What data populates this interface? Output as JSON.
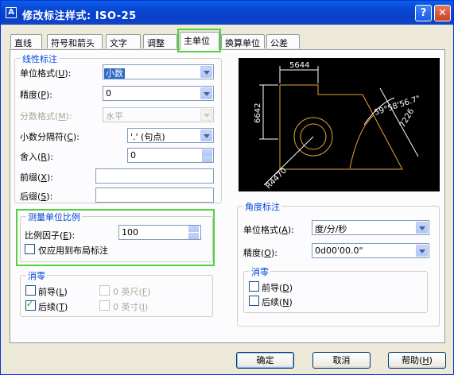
{
  "window": {
    "title": "修改标注样式: ISO-25",
    "help_glyph": "?",
    "close_glyph": "✕",
    "icon": "dimension-style-icon"
  },
  "tabs": [
    "直线",
    "符号和箭头",
    "文字",
    "调整",
    "主单位",
    "换算单位",
    "公差"
  ],
  "active_tab": "主单位",
  "linear": {
    "group_label": "线性标注",
    "unit_format_label": "单位格式",
    "unit_format_key": "U",
    "unit_format_value": "小数",
    "precision_label": "精度",
    "precision_key": "P",
    "precision_value": "0",
    "fraction_format_label": "分数格式",
    "fraction_format_key": "M",
    "fraction_format_value": "水平",
    "decimal_separator_label": "小数分隔符",
    "decimal_separator_key": "C",
    "decimal_separator_value": "'.' (句点)",
    "round_off_label": "舍入",
    "round_off_key": "R",
    "round_off_value": "0",
    "prefix_label": "前缀",
    "prefix_key": "X",
    "prefix_value": "",
    "suffix_label": "后缀",
    "suffix_key": "S",
    "suffix_value": ""
  },
  "scale": {
    "group_label": "测量单位比例",
    "factor_label": "比例因子",
    "factor_key": "E",
    "factor_value": "100",
    "layout_only_label": "仅应用到布局标注",
    "layout_only_checked": false
  },
  "zero_linear": {
    "group_label": "消零",
    "leading_label": "前导",
    "leading_key": "L",
    "leading_checked": false,
    "trailing_label": "后续",
    "trailing_key": "T",
    "trailing_checked": true,
    "feet_label": "0 英尺",
    "feet_key": "F",
    "inches_label": "0 英寸",
    "inches_key": "I"
  },
  "angular": {
    "group_label": "角度标注",
    "unit_format_label": "单位格式",
    "unit_format_key": "A",
    "unit_format_value": "度/分/秒",
    "precision_label": "精度",
    "precision_key": "O",
    "precision_value": "0d00'00.0\""
  },
  "zero_angular": {
    "group_label": "消零",
    "leading_label": "前导",
    "leading_key": "D",
    "leading_checked": false,
    "trailing_label": "后续",
    "trailing_key": "N",
    "trailing_checked": false
  },
  "preview": {
    "dim_top": "5644",
    "dim_left": "6642",
    "dim_angle": "59°58'56.7\"",
    "dim_aligned": "7226",
    "dim_radius": "R4470"
  },
  "buttons": {
    "ok": "确定",
    "cancel": "取消",
    "help": "帮助",
    "help_key": "H"
  },
  "colors": {
    "titlebar": "#0a5fe6",
    "highlight": "#52d13b",
    "group_label": "#0046d5",
    "preview_bg": "#000000",
    "preview_geometry": "#e8a33c"
  }
}
